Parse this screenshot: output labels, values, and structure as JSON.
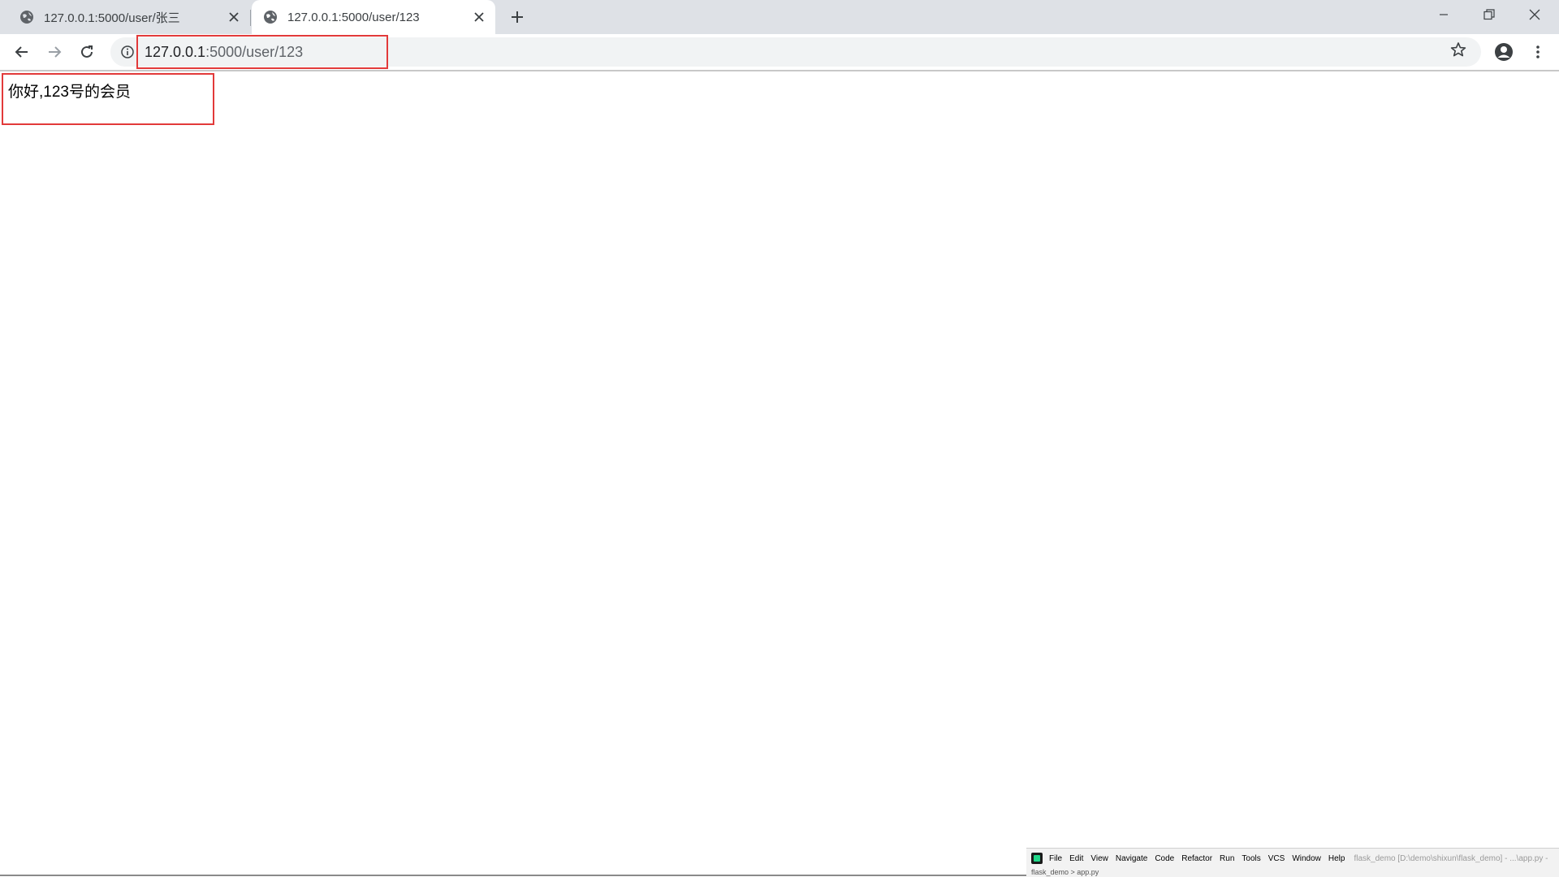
{
  "browser": {
    "tabs": [
      {
        "title": "127.0.0.1:5000/user/张三",
        "active": false
      },
      {
        "title": "127.0.0.1:5000/user/123",
        "active": true
      }
    ],
    "url_host": "127.0.0.1",
    "url_rest": ":5000/user/123",
    "accent_color": "#e23a3a"
  },
  "page": {
    "message": "你好,123号的会员"
  },
  "ide": {
    "menu": [
      "File",
      "Edit",
      "View",
      "Navigate",
      "Code",
      "Refactor",
      "Run",
      "Tools",
      "VCS",
      "Window",
      "Help"
    ],
    "project_title": "flask_demo [D:\\demo\\shixun\\flask_demo] - ...\\app.py -",
    "breadcrumb": "flask_demo  >  app.py"
  }
}
